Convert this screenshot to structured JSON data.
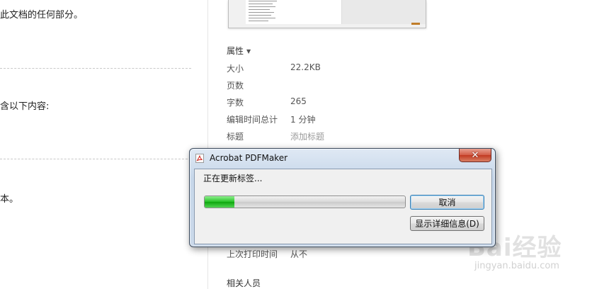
{
  "left_panel": {
    "lines": [
      "此文档的任何部分。",
      "含以下内容:",
      "本。"
    ]
  },
  "properties": {
    "header": "属性",
    "rows": [
      {
        "label": "大小",
        "value": "22.2KB"
      },
      {
        "label": "页数",
        "value": ""
      },
      {
        "label": "字数",
        "value": "265"
      },
      {
        "label": "编辑时间总计",
        "value": "1 分钟"
      },
      {
        "label": "标题",
        "value": "添加标题"
      }
    ],
    "last_printed": {
      "label": "上次打印时间",
      "value": "从不"
    },
    "related_people": "相关人员"
  },
  "dialog": {
    "title": "Acrobat PDFMaker",
    "status": "正在更新标签...",
    "progress_fraction": 0.15,
    "cancel_label": "取消",
    "details_label": "显示详细信息(D)",
    "close_symbol": "✕"
  },
  "watermark": {
    "main": "Bai经验",
    "sub": "jingyan.baidu.com"
  },
  "colors": {
    "progress_green": "#27c227",
    "dialog_frame": "#c7d7ea",
    "close_red": "#c23a22"
  }
}
